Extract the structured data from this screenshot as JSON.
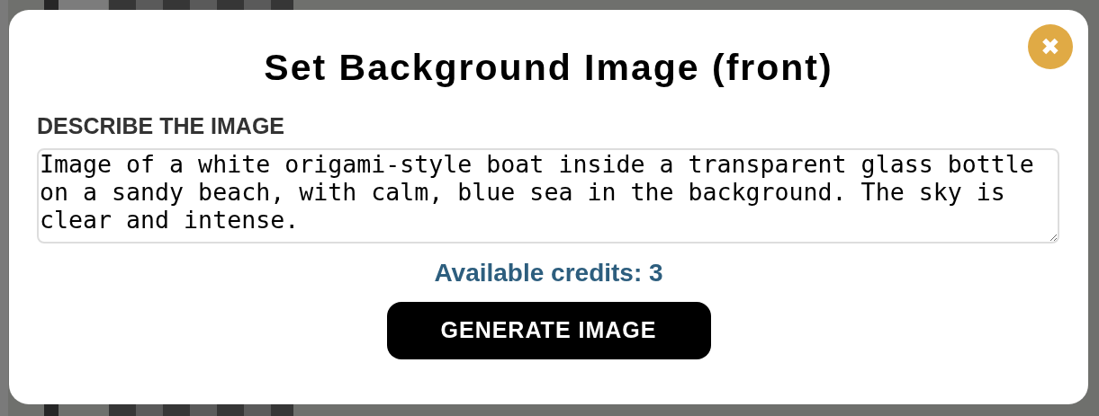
{
  "dialog": {
    "title": "Set Background Image (front)",
    "close_icon": "✖"
  },
  "description": {
    "label": "DESCRIBE THE IMAGE",
    "value": "Image of a white origami-style boat inside a transparent glass bottle on a sandy beach, with calm, blue sea in the background. The sky is clear and intense."
  },
  "credits": "Available credits: 3",
  "generate_button": "GENERATE IMAGE"
}
